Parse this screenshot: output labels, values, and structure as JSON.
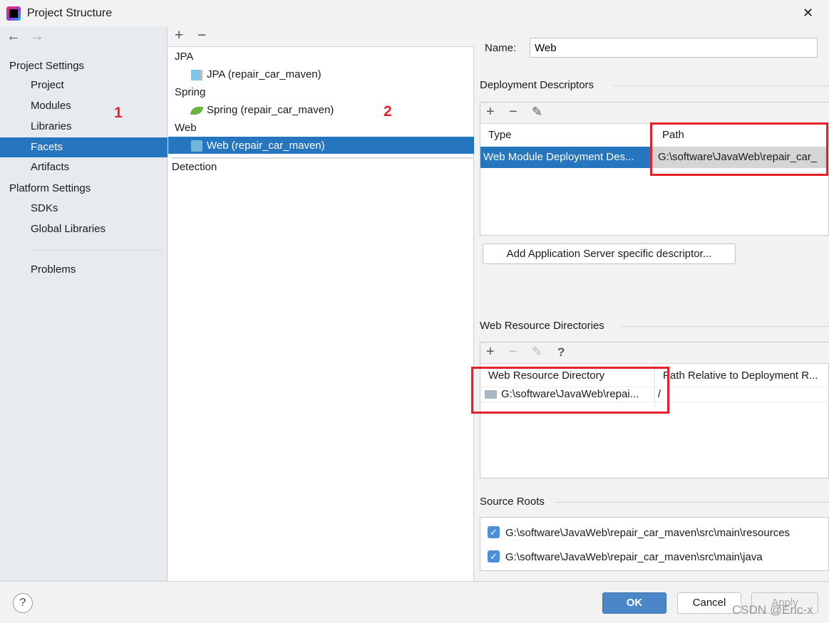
{
  "window": {
    "title": "Project Structure",
    "close": "✕"
  },
  "nav": {
    "back": "←",
    "forward": "→"
  },
  "sidebar": {
    "project_settings": "Project Settings",
    "items": [
      "Project",
      "Modules",
      "Libraries",
      "Facets",
      "Artifacts"
    ],
    "platform_settings": "Platform Settings",
    "platform_items": [
      "SDKs",
      "Global Libraries"
    ],
    "problems": "Problems",
    "selected": "Facets"
  },
  "annotations": {
    "one": "1",
    "two": "2"
  },
  "facets": {
    "add": "+",
    "remove": "−",
    "groups": [
      {
        "label": "JPA",
        "item": "JPA (repair_car_maven)"
      },
      {
        "label": "Spring",
        "item": "Spring (repair_car_maven)"
      },
      {
        "label": "Web",
        "item": "Web (repair_car_maven)"
      }
    ],
    "detection": "Detection",
    "selected": "Web (repair_car_maven)"
  },
  "detail": {
    "name_label": "Name:",
    "name_value": "Web",
    "deployment": {
      "title": "Deployment Descriptors",
      "columns": [
        "Type",
        "Path"
      ],
      "rows": [
        [
          "Web Module Deployment Des...",
          "G:\\software\\JavaWeb\\repair_car_"
        ]
      ],
      "add_server_button": "Add Application Server specific descriptor..."
    },
    "web_resources": {
      "title": "Web Resource Directories",
      "help": "?",
      "columns": [
        "Web Resource Directory",
        "Path Relative to Deployment R..."
      ],
      "rows": [
        [
          "G:\\software\\JavaWeb\\repai...",
          "/"
        ]
      ]
    },
    "source_roots": {
      "title": "Source Roots",
      "items": [
        {
          "path": "G:\\software\\JavaWeb\\repair_car_maven\\src\\main\\resources",
          "checked": true
        },
        {
          "path": "G:\\software\\JavaWeb\\repair_car_maven\\src\\main\\java",
          "checked": true
        }
      ]
    }
  },
  "footer": {
    "help": "?",
    "ok": "OK",
    "cancel": "Cancel",
    "apply": "Apply",
    "watermark": "CSDN @Eric-x"
  },
  "colors": {
    "selection": "#2675bf",
    "highlight_box": "#e8202a",
    "ok_button": "#4a86c8"
  }
}
